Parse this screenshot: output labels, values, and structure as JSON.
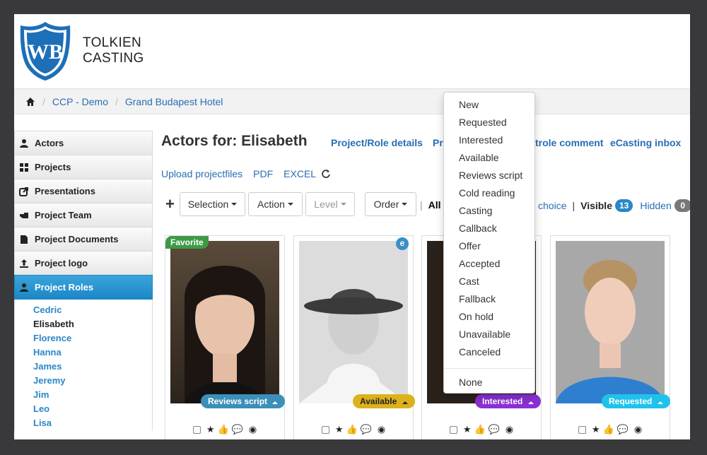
{
  "brand": {
    "logo_text": "WB",
    "line1": "TOLKIEN",
    "line2": "CASTING"
  },
  "breadcrumb": {
    "home_icon": "home-icon",
    "items": [
      "CCP - Demo",
      "Grand Budapest Hotel"
    ]
  },
  "sidebar": {
    "items": [
      {
        "label": "Actors",
        "icon": "user-icon"
      },
      {
        "label": "Projects",
        "icon": "grid-icon"
      },
      {
        "label": "Presentations",
        "icon": "share-icon"
      },
      {
        "label": "Project Team",
        "icon": "hand-icon"
      },
      {
        "label": "Project Documents",
        "icon": "file-icon"
      },
      {
        "label": "Project logo",
        "icon": "upload-icon"
      },
      {
        "label": "Project Roles",
        "icon": "user-icon"
      }
    ],
    "roles": [
      "Cedric",
      "Elisabeth",
      "Florence",
      "Hanna",
      "James",
      "Jeremy",
      "Jim",
      "Leo",
      "Lisa"
    ],
    "current_role": "Elisabeth"
  },
  "main": {
    "title": "Actors for: Elisabeth",
    "links": [
      "Project/Role details",
      "Pro",
      "trole comment",
      "eCasting inbox"
    ],
    "files": [
      "Upload projectfiles",
      "PDF",
      "EXCEL"
    ],
    "toolbar": {
      "selection": "Selection",
      "action": "Action",
      "level": "Level",
      "order": "Order"
    },
    "filters": {
      "all": "All",
      "choice": "choice",
      "visible_label": "Visible",
      "visible_count": "13",
      "hidden_label": "Hidden",
      "hidden_count": "0"
    }
  },
  "cards": [
    {
      "favorite": "Favorite",
      "status": "Reviews script",
      "status_color": "#3b8fb8"
    },
    {
      "ebadge": "e",
      "status": "Available",
      "status_color": "#dcb11a"
    },
    {
      "status": "Interested",
      "status_color": "#8b2fd6"
    },
    {
      "status": "Requested",
      "status_color": "#1fc2ea"
    }
  ],
  "dropdown": {
    "items": [
      "New",
      "Requested",
      "Interested",
      "Available",
      "Reviews script",
      "Cold reading",
      "Casting",
      "Callback",
      "Offer",
      "Accepted",
      "Cast",
      "Fallback",
      "On hold",
      "Unavailable",
      "Canceled"
    ],
    "none": "None"
  }
}
